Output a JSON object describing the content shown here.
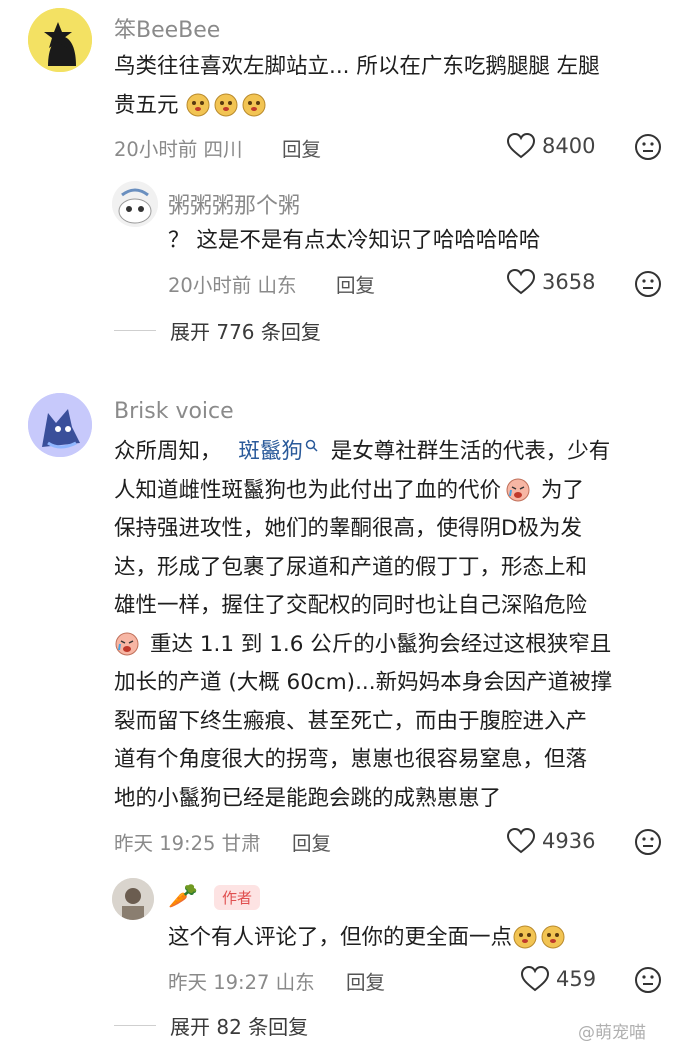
{
  "comments": [
    {
      "username": "笨BeeBee",
      "text_lines": [
        "鸟类往往喜欢左脚站立... 所以在广东吃鹅腿腿 左腿",
        "贵五元"
      ],
      "meta": "20小时前 四川",
      "reply_label": "回复",
      "likes": "8400",
      "reply": {
        "username": "粥粥粥那个粥",
        "text": "？ 这是不是有点太冷知识了哈哈哈哈哈",
        "meta": "20小时前 山东",
        "reply_label": "回复",
        "likes": "3658"
      },
      "expand_label": "展开 776 条回复"
    },
    {
      "username": "Brisk voice",
      "line1_pre": "众所周知，",
      "line1_link": "斑鬣狗",
      "line1_post": "是女尊社群生活的代表，少有",
      "text_lines": [
        "人知道雌性斑鬣狗也为此付出了血的代价",
        "保持强进攻性，她们的睾酮很高，使得阴D极为发",
        "达，形成了包裹了尿道和产道的假丁丁，形态上和",
        "雄性一样，握住了交配权的同时也让自己深陷危险",
        "重达 1.1 到 1.6 公斤的小鬣狗会经过这根狭窄且",
        "加长的产道 (大概 60cm)...新妈妈本身会因产道被撑",
        "裂而留下终生瘢痕、甚至死亡，而由于腹腔进入产",
        "道有个角度很大的拐弯，崽崽也很容易窒息，但落",
        "地的小鬣狗已经是能跑会跳的成熟崽崽了"
      ],
      "line2_post": "为了",
      "meta": "昨天 19:25 甘肃",
      "reply_label": "回复",
      "likes": "4936",
      "reply": {
        "username": "🥕",
        "author_tag": "作者",
        "text": "这个有人评论了，但你的更全面一点",
        "meta": "昨天 19:27 山东",
        "reply_label": "回复",
        "likes": "459"
      },
      "expand_label": "展开 82 条回复"
    }
  ],
  "watermark": "@萌宠喵",
  "icons": {
    "like": "heart-outline-icon",
    "dislike": "meh-face-icon",
    "search": "search-icon"
  },
  "colors": {
    "meta": "#8a8a8a",
    "link": "#2a5a9a",
    "tag_bg": "#fde3e3",
    "tag_text": "#e05050"
  }
}
